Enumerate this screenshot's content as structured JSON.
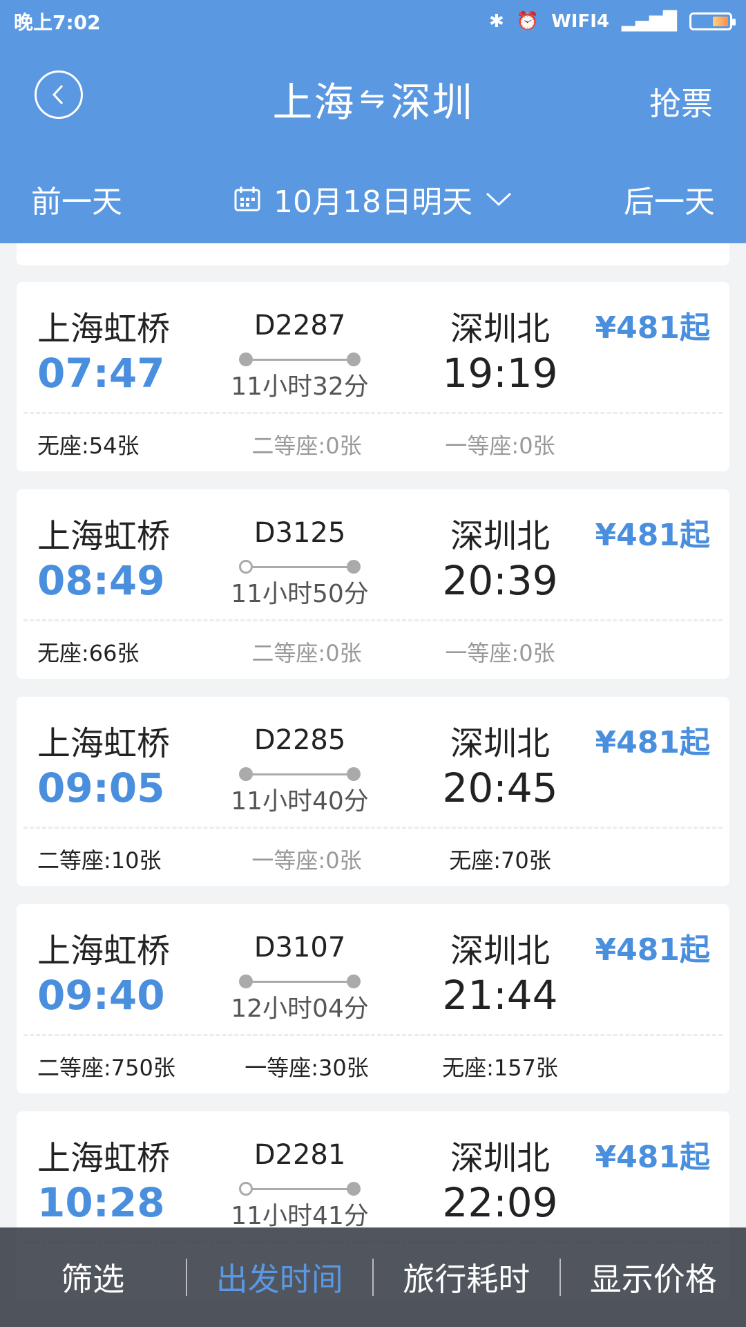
{
  "status_bar": {
    "time": "晚上7:02",
    "wifi_label": "WIFI4"
  },
  "header": {
    "title_from": "上海",
    "title_swap": "⇋",
    "title_to": "深圳",
    "grab_ticket": "抢票",
    "prev_day": "前一天",
    "date": "10月18日明天",
    "next_day": "后一天"
  },
  "trains": [
    {
      "from": "上海虹桥",
      "dep": "07:47",
      "train_no": "D2287",
      "duration": "11小时32分",
      "to": "深圳北",
      "arr": "19:19",
      "price": "¥481起",
      "start_dot": "filled",
      "seats": [
        {
          "label": "无座:54张",
          "available": true
        },
        {
          "label": "二等座:0张",
          "available": false
        },
        {
          "label": "一等座:0张",
          "available": false
        }
      ]
    },
    {
      "from": "上海虹桥",
      "dep": "08:49",
      "train_no": "D3125",
      "duration": "11小时50分",
      "to": "深圳北",
      "arr": "20:39",
      "price": "¥481起",
      "start_dot": "hollow",
      "seats": [
        {
          "label": "无座:66张",
          "available": true
        },
        {
          "label": "二等座:0张",
          "available": false
        },
        {
          "label": "一等座:0张",
          "available": false
        }
      ]
    },
    {
      "from": "上海虹桥",
      "dep": "09:05",
      "train_no": "D2285",
      "duration": "11小时40分",
      "to": "深圳北",
      "arr": "20:45",
      "price": "¥481起",
      "start_dot": "filled",
      "seats": [
        {
          "label": "二等座:10张",
          "available": true
        },
        {
          "label": "一等座:0张",
          "available": false
        },
        {
          "label": "无座:70张",
          "available": true
        }
      ]
    },
    {
      "from": "上海虹桥",
      "dep": "09:40",
      "train_no": "D3107",
      "duration": "12小时04分",
      "to": "深圳北",
      "arr": "21:44",
      "price": "¥481起",
      "start_dot": "filled",
      "seats": [
        {
          "label": "二等座:750张",
          "available": true
        },
        {
          "label": "一等座:30张",
          "available": true
        },
        {
          "label": "无座:157张",
          "available": true
        }
      ]
    },
    {
      "from": "上海虹桥",
      "dep": "10:28",
      "train_no": "D2281",
      "duration": "11小时41分",
      "to": "深圳北",
      "arr": "22:09",
      "price": "¥481起",
      "start_dot": "hollow",
      "seats": [
        {
          "label": "",
          "available": true
        },
        {
          "label": "",
          "available": false
        },
        {
          "label": "",
          "available": false
        }
      ]
    }
  ],
  "bottom_bar": {
    "tabs": [
      {
        "label": "筛选",
        "active": false
      },
      {
        "label": "出发时间",
        "active": true
      },
      {
        "label": "旅行耗时",
        "active": false
      },
      {
        "label": "显示价格",
        "active": false
      }
    ]
  },
  "colors": {
    "header_bg": "#5a98e2",
    "accent": "#4a8fde",
    "bottom_bar": "#3a3f48"
  }
}
